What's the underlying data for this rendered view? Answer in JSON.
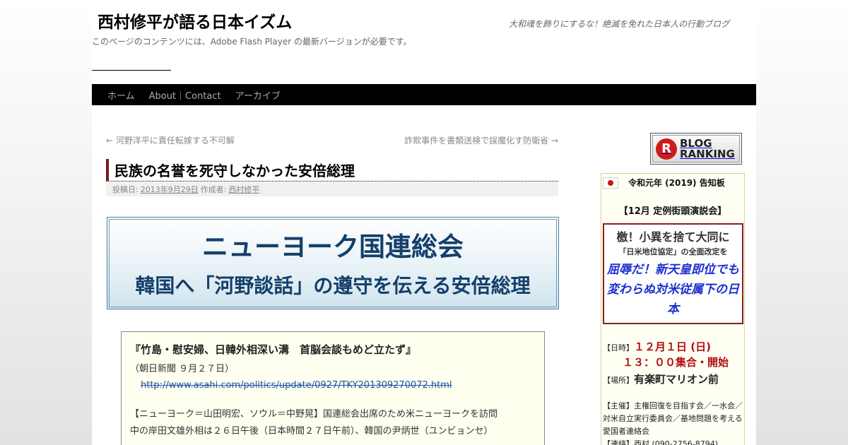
{
  "site": {
    "title": "西村修平が語る日本イズム",
    "description": "大和魂を飾りにするな！絶滅を免れた日本人の行動ブログ",
    "flash_note": "このページのコンテンツには、Adobe Flash Player の最新バージョンが必要です。"
  },
  "nav": {
    "items": [
      {
        "label": "ホーム"
      },
      {
        "label": "About｜Contact"
      },
      {
        "label": "アーカイブ"
      }
    ]
  },
  "post_nav": {
    "prev": "← 河野洋平に責任転嫁する不可解",
    "next": "詐欺事件を書類送検で誤魔化す防衛省 →"
  },
  "post": {
    "title": "民族の名誉を死守しなかった安倍総理",
    "meta_posted_label": "投稿日:",
    "meta_date": "2013年9月29日",
    "meta_author_label": "作成者:",
    "meta_author": "西村修平",
    "banner_line1": "ニューヨーク国連総会",
    "banner_line2": "韓国へ「河野談話」の遵守を伝える安倍総理",
    "quote_title": "『竹島・慰安婦、日韓外相深い溝　首脳会談もめど立たず』",
    "quote_source": "（朝日新聞 ９月２７日）",
    "quote_link": "http://www.asahi.com/politics/update/0927/TKY201309270072.html",
    "quote_body_1": "【ニューヨーク＝山田明宏、ソウル＝中野晃】国連総会出席のため米ニューヨークを訪問",
    "quote_body_2": "中の岸田文雄外相は２６日午後（日本時間２７日午前）、韓国の尹炳世（ユンビョンセ）"
  },
  "sidebar": {
    "ranking": {
      "logo": "R",
      "line1": "BLOG",
      "line2": "RANKING"
    },
    "notice": {
      "title": "令和元年 (2019) 告知板",
      "subtitle": "【12月 定例街頭演説会】",
      "alert_line1": "檄！小異を捨て大同に",
      "alert_line2": "「日米地位協定」の全面改定を",
      "alert_line3": "屈辱だ！新天皇即位でも変わらぬ対米従属下の日本",
      "date_label": "【日時】",
      "date_value": "１２月１日 (日)",
      "time_value": "１３：００集合・開始",
      "place_label": "【場所】",
      "place_value": "有楽町マリオン前",
      "organizer": "【主催】主権回復を目指す会／一水会／対米自立実行委員会／基地問題を考える愛国者連絡会",
      "contact": "【連絡】西村 (090-2756-8794)"
    }
  },
  "colors": {
    "nav_bg": "#000000",
    "title_accent": "#7a1c1c",
    "banner_text": "#153f6b",
    "alert_blue": "#1a2fd0",
    "alert_red": "#b01010"
  }
}
